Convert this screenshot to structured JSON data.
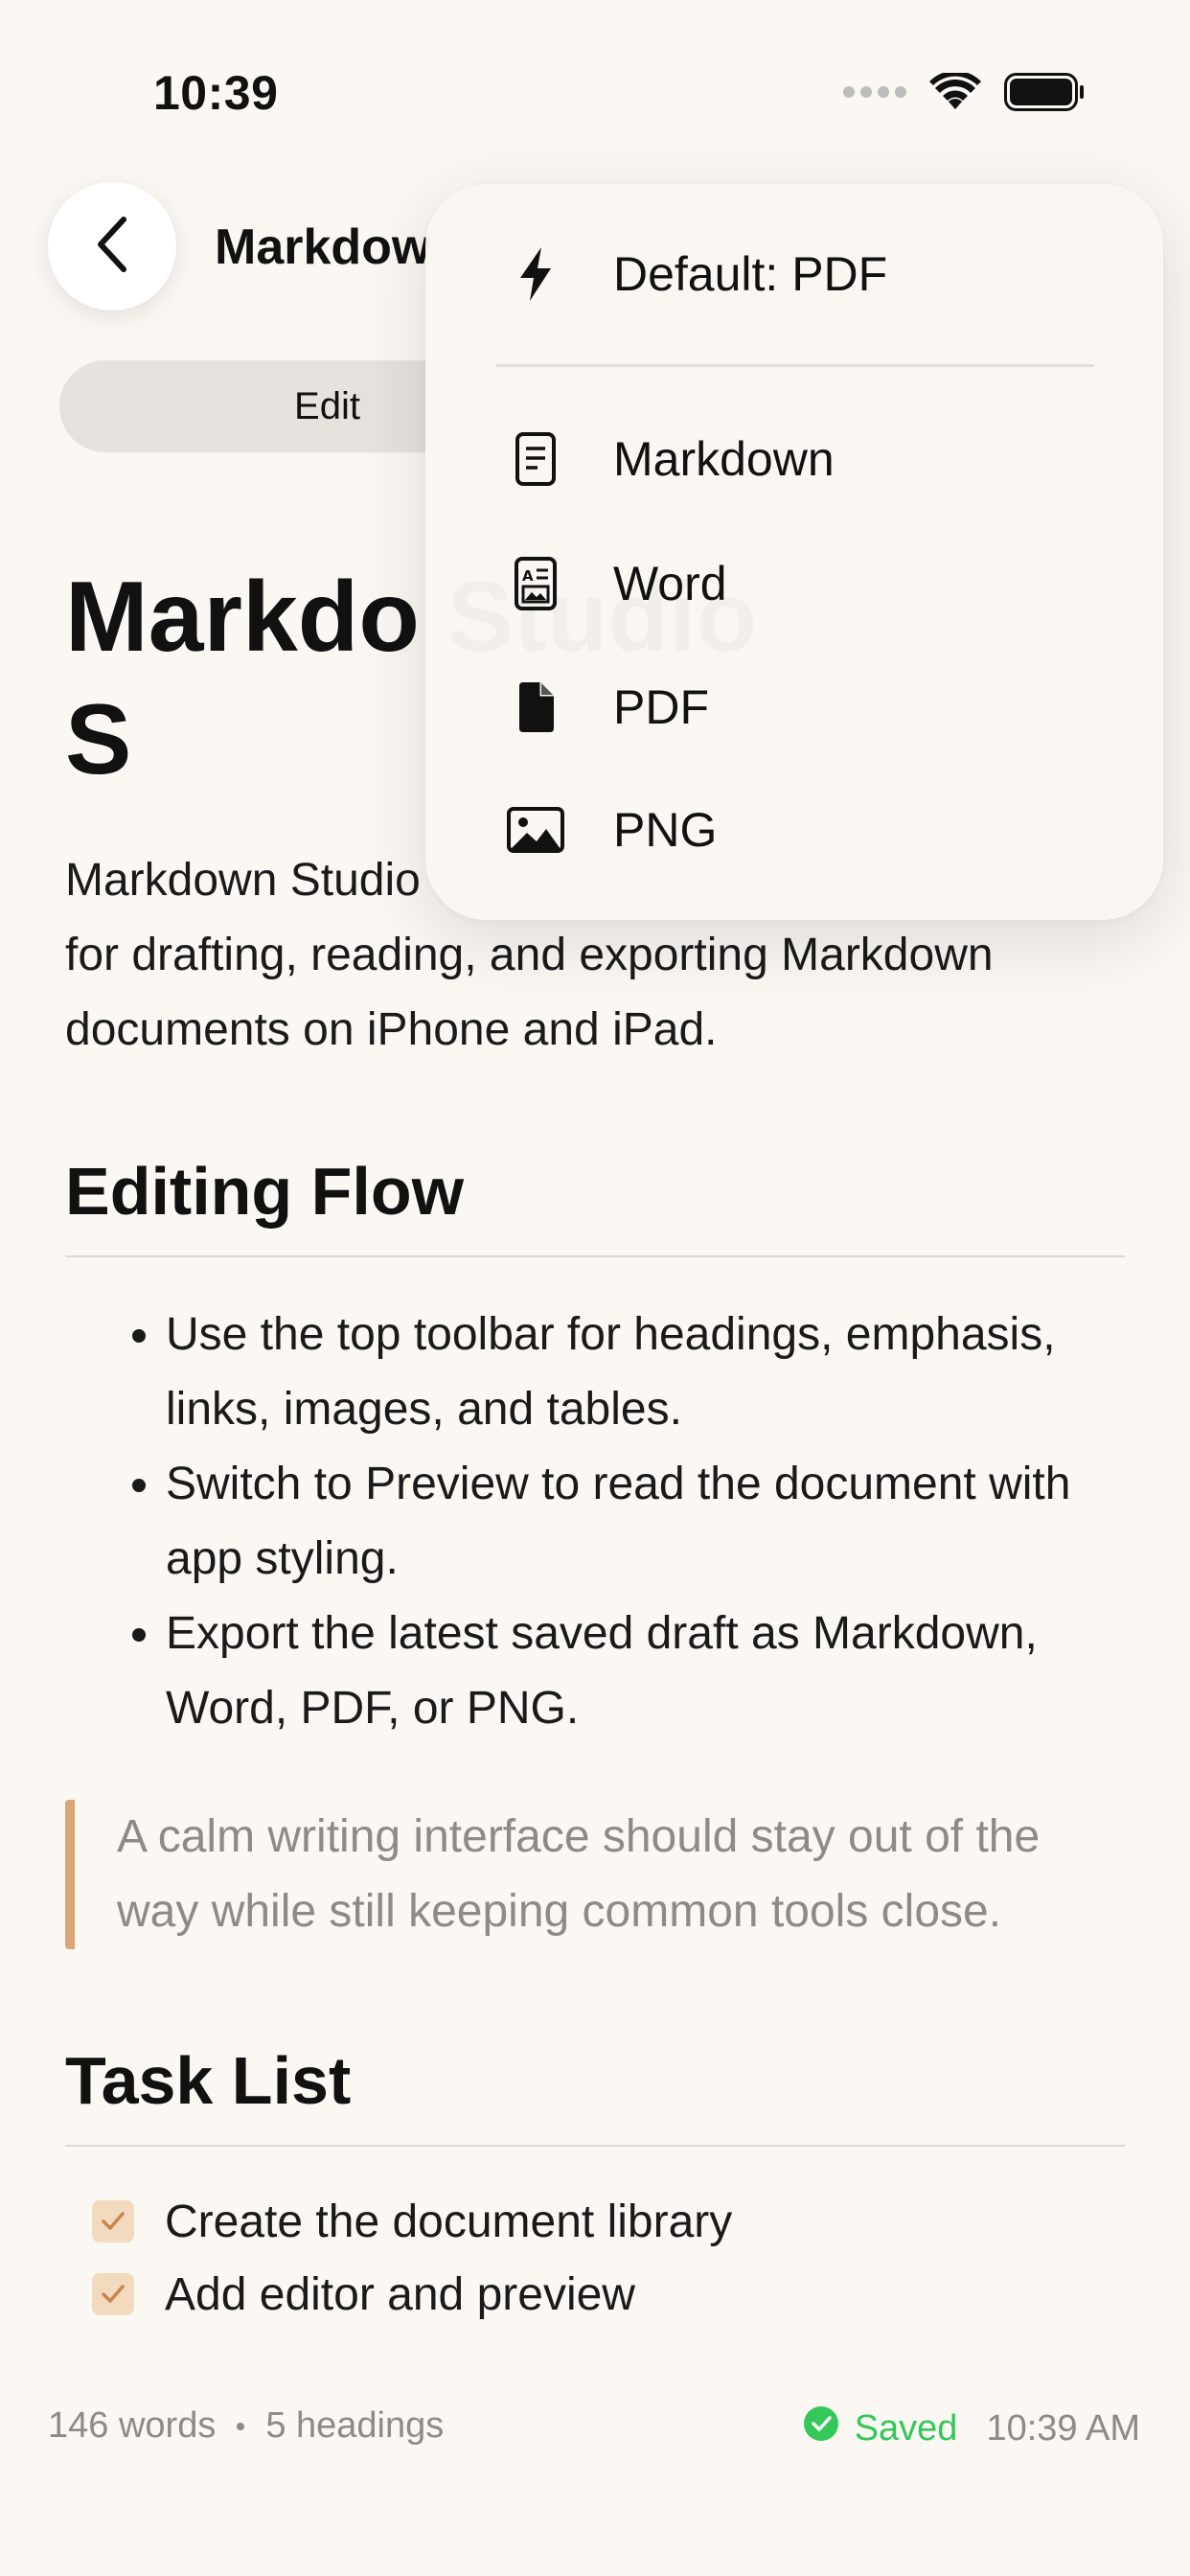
{
  "status_bar": {
    "time": "10:39"
  },
  "nav": {
    "title": "Markdow",
    "back_icon": "chevron-left-icon"
  },
  "segmented": {
    "edit_label": "Edit",
    "preview_label": ""
  },
  "document": {
    "title": "Markdo Studio S",
    "intro": "Markdown Studio\nfor drafting, reading, and exporting Markdown documents on iPhone and iPad.",
    "sections": [
      {
        "heading": "Editing Flow",
        "bullets": [
          "Use the top toolbar for headings, emphasis, links, images, and tables.",
          "Switch to Preview to read the document with app styling.",
          "Export the latest saved draft as Markdown, Word, PDF, or PNG."
        ],
        "quote": "A calm writing interface should stay out of the way while still keeping common tools close."
      },
      {
        "heading": "Task List",
        "tasks": [
          {
            "label": "Create the document library",
            "checked": true
          },
          {
            "label": "Add editor and preview",
            "checked": true
          }
        ]
      }
    ]
  },
  "footer": {
    "words": "146 words",
    "headings": "5 headings",
    "saved": "Saved",
    "time": "10:39 AM",
    "saved_color": "#34C759"
  },
  "export_menu": {
    "default_item": {
      "label": "Default: PDF",
      "icon": "bolt-icon"
    },
    "items": [
      {
        "label": "Markdown",
        "icon": "document-text-icon"
      },
      {
        "label": "Word",
        "icon": "word-document-icon"
      },
      {
        "label": "PDF",
        "icon": "pdf-file-icon"
      },
      {
        "label": "PNG",
        "icon": "image-icon"
      }
    ]
  },
  "colors": {
    "background": "#FBF8F4",
    "accent_quote": "#D8A676",
    "checkbox_fill": "#F3D9BE",
    "checkmark": "#C9864A"
  }
}
